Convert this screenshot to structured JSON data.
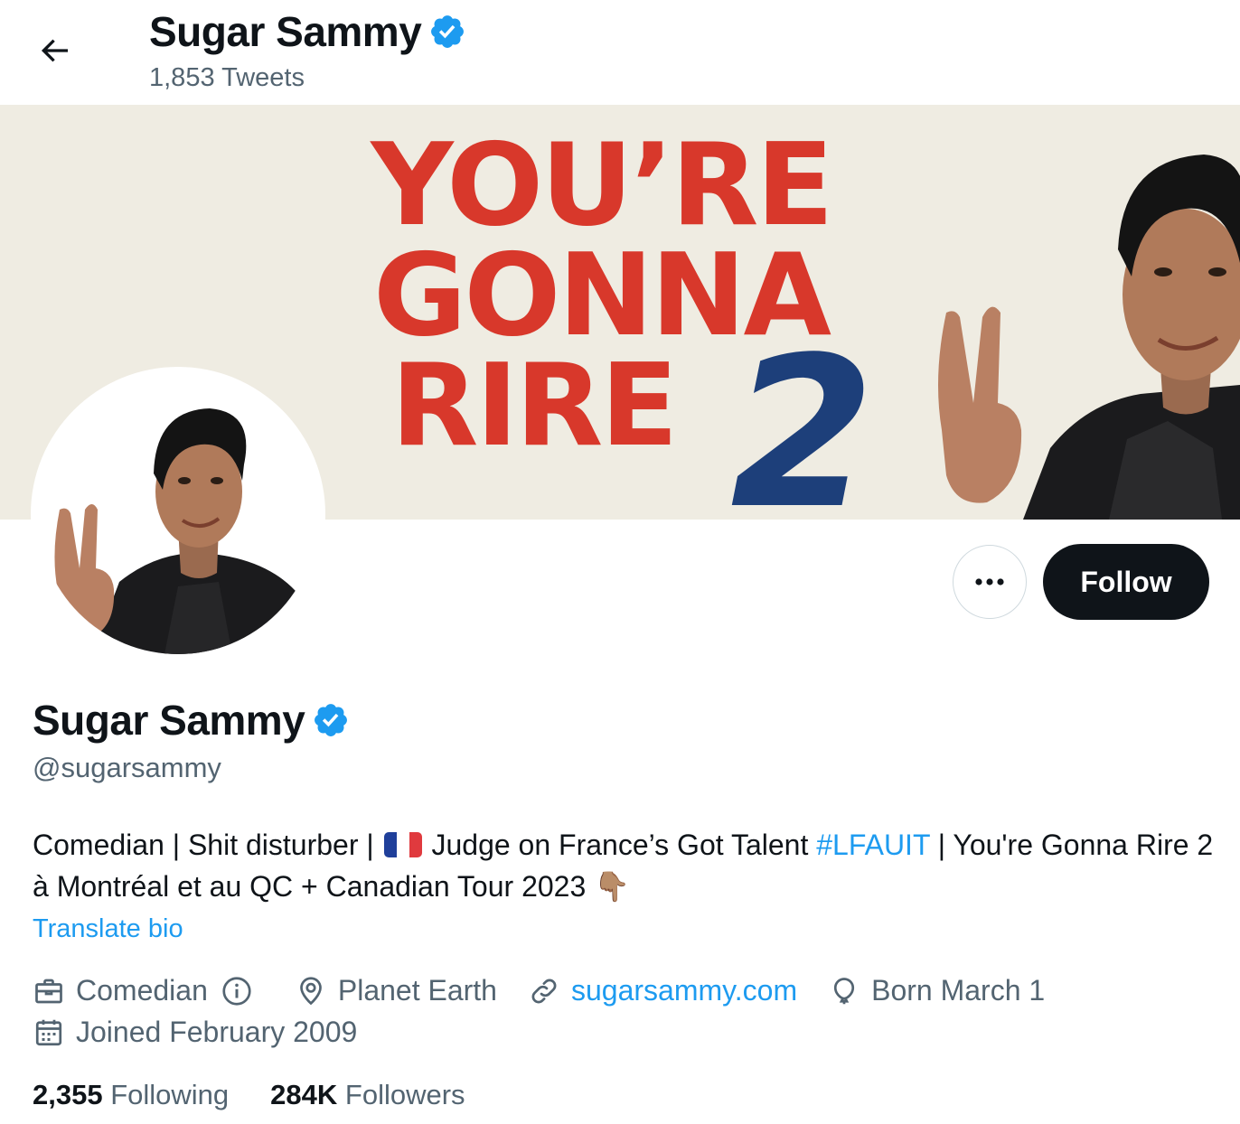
{
  "header": {
    "name": "Sugar Sammy",
    "tweet_count": "1,853 Tweets"
  },
  "banner": {
    "line1": "YOU’RE",
    "line2": "GONNA",
    "line3": "RIRE",
    "number": "2"
  },
  "actions": {
    "follow_label": "Follow"
  },
  "profile": {
    "display_name": "Sugar Sammy",
    "handle": "@sugarsammy",
    "bio_part1": "Comedian | Shit disturber | ",
    "bio_part2": " Judge on France’s Got Talent ",
    "bio_hashtag": "#LFAUIT",
    "bio_part3": " | You're Gonna Rire 2 à Montréal et au QC + Canadian Tour 2023 ",
    "bio_emoji": "👇🏽",
    "translate_label": "Translate bio",
    "category": "Comedian",
    "location": "Planet Earth",
    "website": "sugarsammy.com",
    "birthday": "Born March 1",
    "joined": "Joined February 2009"
  },
  "stats": {
    "following_count": "2,355",
    "following_label": "Following",
    "followers_count": "284K",
    "followers_label": "Followers"
  },
  "colors": {
    "accent": "#1d9bf0",
    "verified": "#1d9bf0",
    "banner_red": "#d8382b",
    "banner_blue": "#1d3f7a",
    "banner_bg": "#efece2"
  }
}
